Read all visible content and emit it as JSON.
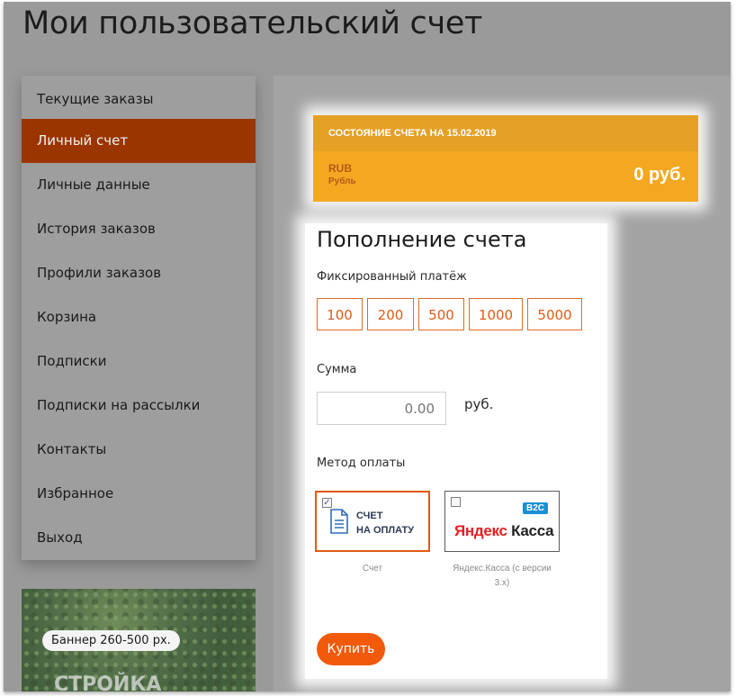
{
  "page": {
    "title": "Мои пользовательский счет"
  },
  "sidebar": {
    "items": [
      {
        "label": "Текущие заказы"
      },
      {
        "label": "Личный счет"
      },
      {
        "label": "Личные данные"
      },
      {
        "label": "История заказов"
      },
      {
        "label": "Профили заказов"
      },
      {
        "label": "Корзина"
      },
      {
        "label": "Подписки"
      },
      {
        "label": "Подписки на рассылки"
      },
      {
        "label": "Контакты"
      },
      {
        "label": "Избранное"
      },
      {
        "label": "Выход"
      }
    ],
    "active_index": 1
  },
  "banner": {
    "tag": "Баннер 260-500 px.",
    "text": "СТРОЙКА"
  },
  "account_status": {
    "header": "СОСТОЯНИЕ СЧЕТА НА 15.02.2019",
    "currency_code": "RUB",
    "currency_name": "Рубль",
    "balance": "0 руб."
  },
  "topup": {
    "title": "Пополнение счета",
    "fixed_label": "Фиксированный платёж",
    "amounts": [
      "100",
      "200",
      "500",
      "1000",
      "5000"
    ],
    "sum_label": "Сумма",
    "sum_placeholder": "0.00",
    "sum_unit": "руб.",
    "method_label": "Метод оплаты",
    "methods": [
      {
        "caption": "Счет",
        "logo_line1": "СЧЕТ",
        "logo_line2": "НА ОПЛАТУ",
        "checked": true
      },
      {
        "caption": "Яндекс.Касса (с версии 3.х)",
        "logo_brand": "Яндекс",
        "logo_word": "Касса",
        "badge": "B2C",
        "checked": false
      }
    ],
    "buy_label": "Купить"
  },
  "colors": {
    "accent": "#f05a0a",
    "active_nav": "#9b3500",
    "status_header": "#e4a126",
    "status_body": "#f4a822"
  }
}
